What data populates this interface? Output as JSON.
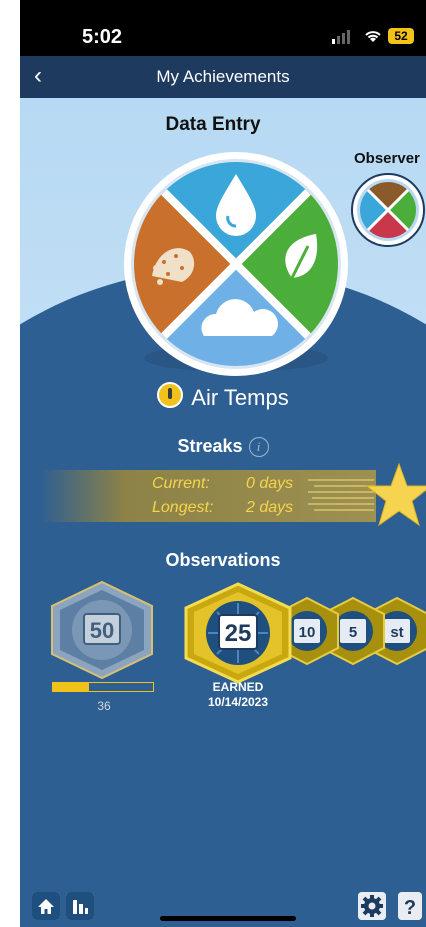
{
  "status_bar": {
    "time": "5:02",
    "battery": "52"
  },
  "nav": {
    "back_label": "‹",
    "title": "My Achievements"
  },
  "categories": {
    "current": "Data Entry",
    "next": "Observer",
    "selected_label": "Air Temps"
  },
  "streaks": {
    "title": "Streaks",
    "info_glyph": "i",
    "current_label": "Current:",
    "current_value": "0 days",
    "longest_label": "Longest:",
    "longest_value": "2 days"
  },
  "observations": {
    "title": "Observations",
    "badges": [
      {
        "label": "50",
        "earned": false,
        "progress": 36,
        "progress_fraction": 0.36
      },
      {
        "label": "25",
        "earned": true,
        "status": "EARNED",
        "date": "10/14/2023"
      },
      {
        "label": "10",
        "earned": true
      },
      {
        "label": "5",
        "earned": true
      },
      {
        "label": "st",
        "earned": true
      }
    ],
    "progress_value": "36",
    "earned_label": "EARNED",
    "earned_date": "10/14/2023"
  },
  "tab_bar": {
    "items": [
      "home-icon",
      "stats-icon",
      "settings-icon",
      "help-icon"
    ]
  },
  "colors": {
    "navy": "#1e3a5f",
    "blue": "#2e5f92",
    "sky": "#b7d9f3",
    "gold": "#f1c21b",
    "wheel_water": "#3ba6d9",
    "wheel_soil": "#c8702c",
    "wheel_plant": "#4cae3a",
    "wheel_cloud": "#6fb0e6"
  }
}
